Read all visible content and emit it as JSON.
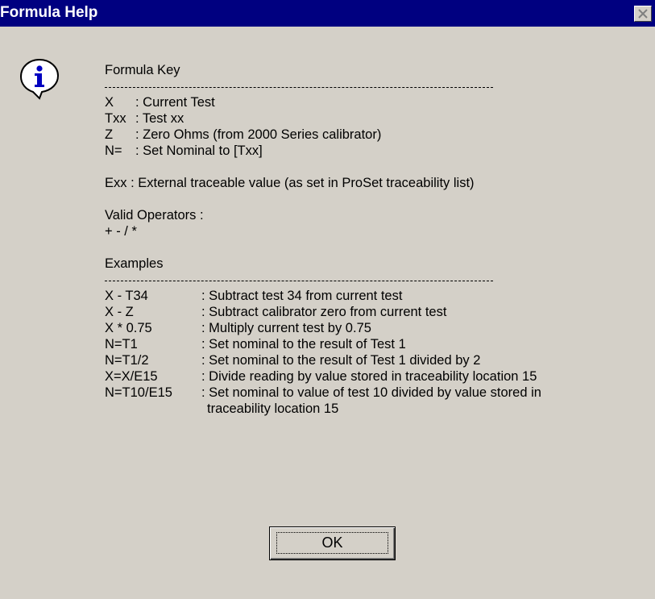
{
  "window": {
    "title": "Formula Help"
  },
  "colors": {
    "titlebar": "#000080",
    "dialog_bg": "#d4d0c8",
    "icon_blue": "#0000c0"
  },
  "icons": {
    "close": "close-icon",
    "info": "info-icon"
  },
  "key_section": {
    "heading": "Formula Key",
    "items": [
      {
        "code": "X",
        "description": ": Current Test"
      },
      {
        "code": "Txx",
        "description": ": Test xx"
      },
      {
        "code": "Z",
        "description": ": Zero Ohms (from 2000 Series calibrator)"
      },
      {
        "code": "N=",
        "description": ": Set Nominal to [Txx]"
      }
    ],
    "external": "Exx  : External traceable value (as set in ProSet traceability list)"
  },
  "operators": {
    "heading": "Valid Operators :",
    "list": "+ - / *"
  },
  "examples_section": {
    "heading": "Examples",
    "items": [
      {
        "code": "X - T34",
        "description": ": Subtract test 34 from current test"
      },
      {
        "code": "X - Z",
        "description": ": Subtract calibrator zero from current test"
      },
      {
        "code": "X * 0.75",
        "description": ": Multiply current test by 0.75"
      },
      {
        "code": "N=T1",
        "description": ": Set nominal to the result of Test 1"
      },
      {
        "code": "N=T1/2",
        "description": ": Set nominal to the result of Test 1 divided by 2"
      },
      {
        "code": "X=X/E15",
        "description": ": Divide reading by value stored in traceability location 15"
      },
      {
        "code": "N=T10/E15",
        "description": ": Set nominal to value of test 10 divided by value stored in"
      }
    ],
    "continuation": "traceability location 15"
  },
  "buttons": {
    "ok_label": "OK"
  }
}
